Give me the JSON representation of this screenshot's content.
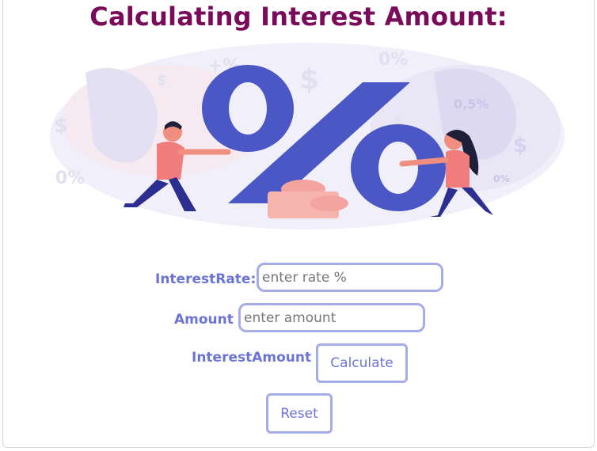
{
  "page": {
    "title": "Calculating Interest Amount:"
  },
  "illustration": {
    "decor_texts": [
      "+%",
      "0%",
      "0,5%",
      "0%",
      "0%"
    ],
    "colors": {
      "primary": "#4a57c4",
      "blob": "#e7e6f6",
      "person_skin": "#f08f7f",
      "coins": "#f3a3a0"
    }
  },
  "form": {
    "rate": {
      "label": "InterestRate:",
      "placeholder": "enter rate %",
      "value": ""
    },
    "amount": {
      "label": "Amount",
      "placeholder": "enter amount",
      "value": ""
    },
    "result": {
      "label": "InterestAmount"
    },
    "calculate_label": "Calculate",
    "reset_label": "Reset"
  },
  "colors": {
    "title": "#7a0a5a",
    "label": "#6b74d6",
    "input_border": "#a6ace8"
  }
}
